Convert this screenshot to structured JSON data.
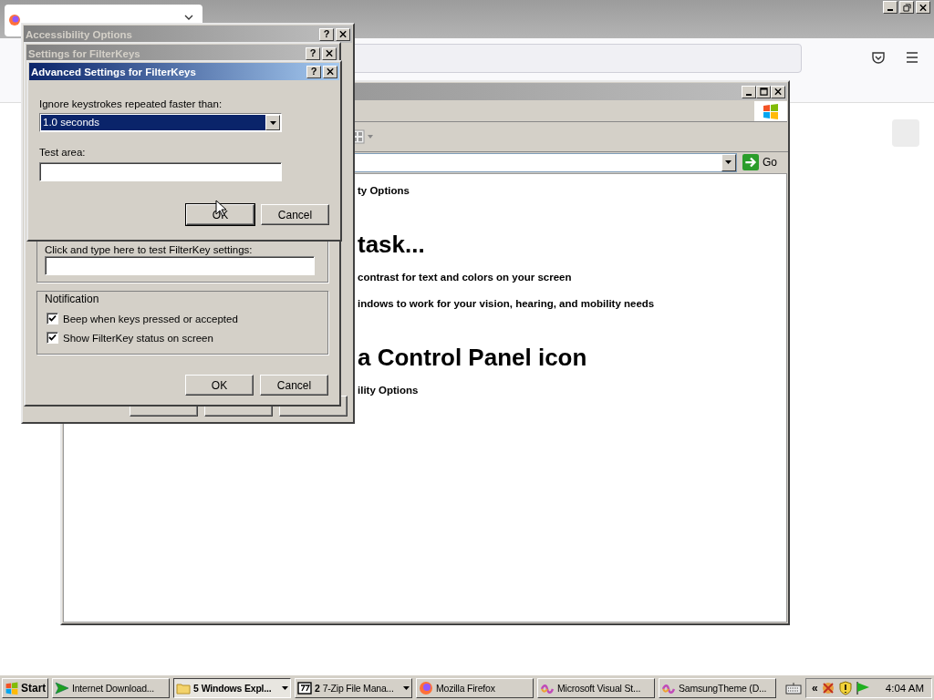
{
  "accessibility_options": {
    "title": "Accessibility Options",
    "active": false,
    "help": "?"
  },
  "filterkeys_settings": {
    "title": "Settings for FilterKeys",
    "active": false,
    "help": "?",
    "test_hint": "Click and type here to test FilterKey settings:",
    "notification": {
      "legend": "Notification",
      "options": [
        {
          "label": "Beep when keys pressed or accepted",
          "checked": true
        },
        {
          "label": "Show FilterKey status on screen",
          "checked": true
        }
      ]
    },
    "buttons": [
      {
        "label": "OK",
        "focused": false
      },
      {
        "label": "Cancel",
        "focused": false
      }
    ]
  },
  "advanced_settings": {
    "title": "Advanced Settings for FilterKeys",
    "active": true,
    "help": "?",
    "repeat_label": "Ignore keystrokes repeated faster than:",
    "repeat_value": "1.0 seconds",
    "test_label": "Test area:",
    "buttons": [
      {
        "label": "OK",
        "focused": true
      },
      {
        "label": "Cancel",
        "focused": false
      }
    ]
  },
  "explorer": {
    "active": false,
    "go_label": "Go",
    "content": [
      {
        "kind": "link",
        "text": "ty Options"
      },
      {
        "kind": "heading",
        "text": "task..."
      },
      {
        "kind": "link",
        "text": "contrast for text and colors on your screen"
      },
      {
        "kind": "link",
        "text": "indows to work for your vision, hearing, and mobility needs"
      },
      {
        "kind": "heading",
        "text": "a Control Panel icon"
      },
      {
        "kind": "link",
        "text": "ility Options"
      }
    ]
  },
  "taskbar": {
    "start": "Start",
    "items": [
      {
        "label": "Internet Download...",
        "selected": false
      },
      {
        "count": "5",
        "label": "Windows Expl...",
        "selected": true
      },
      {
        "count": "2",
        "label": "7-Zip File Mana...",
        "selected": false
      },
      {
        "label": "Mozilla Firefox",
        "selected": false
      },
      {
        "label": "Microsoft Visual St...",
        "selected": false
      },
      {
        "label": "SamsungTheme (D...",
        "selected": false
      }
    ],
    "tray_chevron": "«",
    "clock": "4:04 AM"
  }
}
